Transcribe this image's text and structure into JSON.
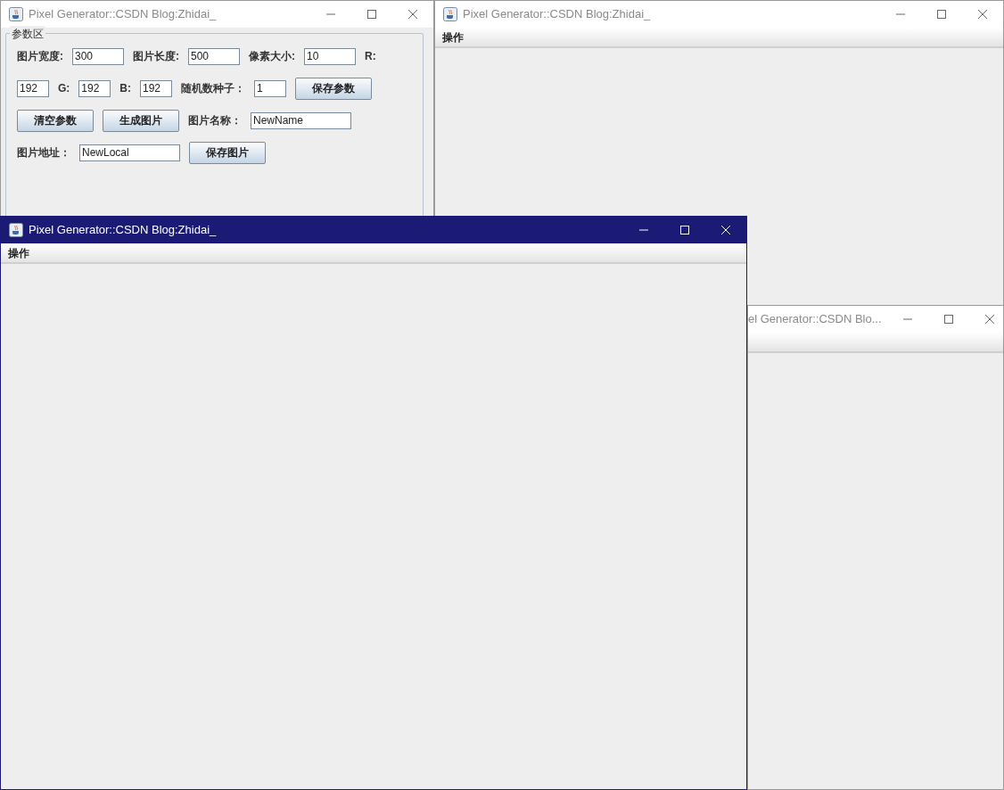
{
  "windows": [
    {
      "title": "Pixel Generator::CSDN Blog:Zhidai_",
      "active": false,
      "icon_visible": true,
      "kind": "form",
      "panel": {
        "legend": "参数区",
        "rows": [
          {
            "items": [
              {
                "kind": "label",
                "text": "图片宽度:"
              },
              {
                "kind": "field",
                "value": "300"
              },
              {
                "kind": "label",
                "text": "图片长度:"
              },
              {
                "kind": "field",
                "value": "500"
              },
              {
                "kind": "label",
                "text": "像素大小:"
              },
              {
                "kind": "field",
                "value": "10"
              },
              {
                "kind": "label",
                "text": "R:"
              }
            ]
          },
          {
            "items": [
              {
                "kind": "field",
                "value": "192"
              },
              {
                "kind": "label",
                "text": "G:"
              },
              {
                "kind": "field",
                "value": "192"
              },
              {
                "kind": "label",
                "text": "B:"
              },
              {
                "kind": "field",
                "value": "192"
              },
              {
                "kind": "label",
                "text": "随机数种子："
              },
              {
                "kind": "field",
                "value": "1"
              },
              {
                "kind": "button",
                "text": "保存参数"
              }
            ]
          },
          {
            "items": [
              {
                "kind": "button",
                "text": "清空参数"
              },
              {
                "kind": "button",
                "text": "生成图片"
              },
              {
                "kind": "label",
                "text": "图片名称："
              },
              {
                "kind": "field",
                "value": "NewName"
              }
            ]
          },
          {
            "items": [
              {
                "kind": "label",
                "text": "图片地址："
              },
              {
                "kind": "field",
                "value": "NewLocal"
              },
              {
                "kind": "button",
                "text": "保存图片"
              }
            ]
          }
        ]
      }
    },
    {
      "title": "Pixel Generator::CSDN Blog:Zhidai_",
      "active": false,
      "icon_visible": true,
      "kind": "menu",
      "menu": [
        "操作"
      ]
    },
    {
      "title": "el Generator::CSDN Blo...",
      "active": false,
      "icon_visible": false,
      "kind": "menu"
    },
    {
      "title": "Pixel Generator::CSDN Blog:Zhidai_",
      "active": true,
      "icon_visible": true,
      "kind": "menu",
      "menu": [
        "操作"
      ]
    }
  ]
}
